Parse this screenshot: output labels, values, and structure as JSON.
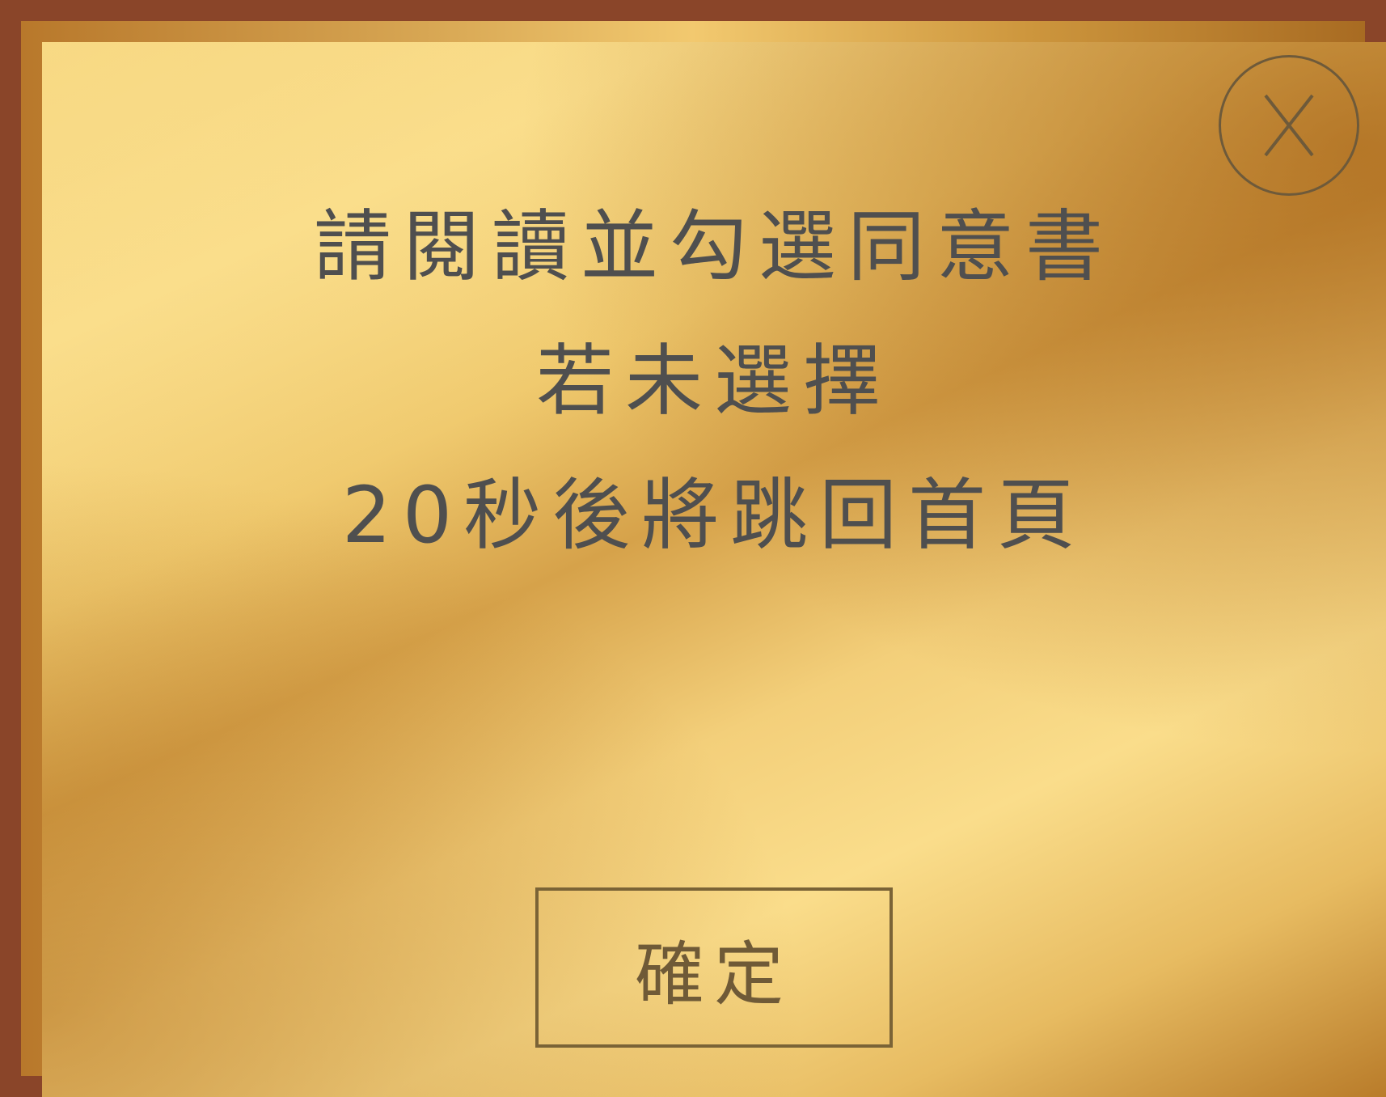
{
  "dialog": {
    "close_button": {
      "icon": "close-icon",
      "label": "X"
    },
    "message_lines": [
      "請閱讀並勾選同意書",
      "若未選擇",
      "20秒後將跳回首頁"
    ],
    "confirm_label": "確定"
  },
  "colors": {
    "border": "#8a4529",
    "gold_light": "#fadd8b",
    "gold_dark": "#b97c2a",
    "text": "#4f4f4f",
    "button_border": "#7a6336"
  }
}
